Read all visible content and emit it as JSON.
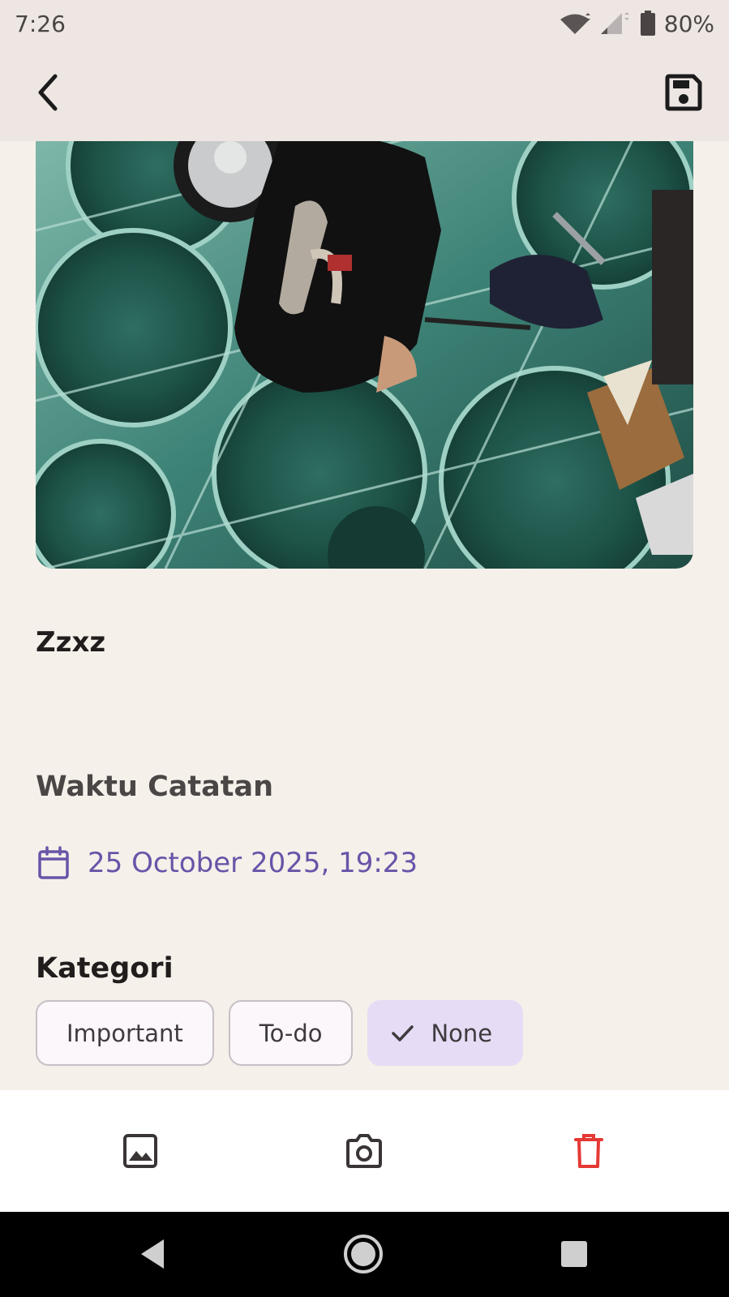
{
  "status_bar": {
    "time": "7:26",
    "battery_percent": "80%",
    "icons": [
      "wifi-icon",
      "signal-icon",
      "battery-icon"
    ]
  },
  "app_bar": {
    "back_icon": "back-arrow-icon",
    "save_icon": "save-icon"
  },
  "note": {
    "photo_icon": "attached-photo",
    "title": "Zzxz"
  },
  "time_section": {
    "label": "Waktu Catatan",
    "date": "25 October 2025, 19:23",
    "icon": "calendar-icon"
  },
  "category_section": {
    "label": "Kategori",
    "chips": [
      {
        "label": "Important",
        "selected": false
      },
      {
        "label": "To-do",
        "selected": false
      },
      {
        "label": "None",
        "selected": true
      }
    ]
  },
  "actions": {
    "gallery_icon": "image-icon",
    "camera_icon": "camera-icon",
    "delete_icon": "trash-icon"
  },
  "colors": {
    "background": "#f5f0ea",
    "appbar": "#ede6e2",
    "accent": "#6a53a8",
    "selected_chip": "#e6dcf5",
    "delete": "#e53935"
  }
}
